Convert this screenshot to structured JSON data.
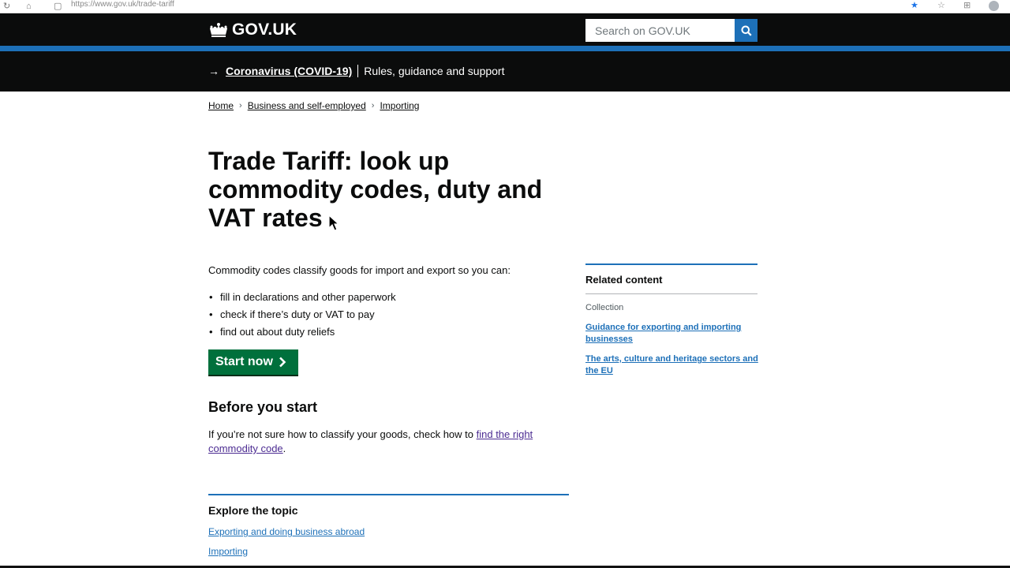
{
  "browser": {
    "url": "https://www.gov.uk/trade-tariff",
    "reload_glyph": "↻",
    "home_glyph": "⌂",
    "page_glyph": "▢",
    "star_glyph": "★",
    "ext1_glyph": "☆",
    "ext2_glyph": "⊞"
  },
  "header": {
    "logo_text": "GOV.UK",
    "search_placeholder": "Search on GOV.UK"
  },
  "covid_banner": {
    "arrow": "→",
    "link_text": "Coronavirus (COVID-19)",
    "text": "Rules, guidance and support"
  },
  "breadcrumb": {
    "items": [
      "Home",
      "Business and self-employed",
      "Importing"
    ],
    "separator": "›"
  },
  "main": {
    "title": "Trade Tariff: look up commodity codes, duty and VAT rates",
    "intro": "Commodity codes classify goods for import and export so you can:",
    "bullets": [
      "fill in declarations and other paperwork",
      "check if there’s duty or VAT to pay",
      "find out about duty reliefs"
    ],
    "start_button": "Start now",
    "before_heading": "Before you start",
    "before_text": "If you’re not sure how to classify your goods, check how to ",
    "before_link": "find the right commodity code",
    "before_end": ".",
    "explore_heading": "Explore the topic",
    "explore_links": [
      "Exporting and doing business abroad",
      "Importing"
    ]
  },
  "sidebar": {
    "heading": "Related content",
    "collection_label": "Collection",
    "links": [
      "Guidance for exporting and importing businesses",
      "The arts, culture and heritage sectors and the EU"
    ]
  },
  "colors": {
    "header_bg": "#0b0c0c",
    "brand_blue": "#1d70b8",
    "start_green": "#00703c",
    "visited_link": "#4c2c92"
  }
}
